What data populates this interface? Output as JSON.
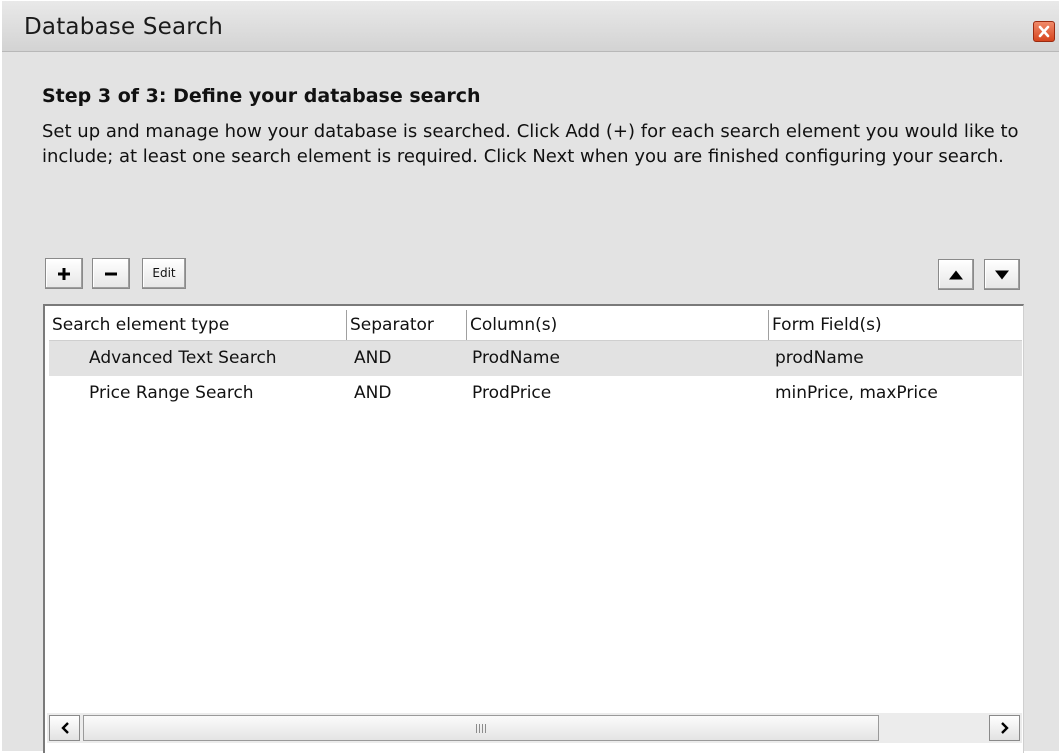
{
  "window": {
    "title": "Database Search",
    "close_icon": "close-icon"
  },
  "step": {
    "heading": "Step 3 of 3: Define your database search",
    "description": "Set up and manage how your database is searched. Click Add (+) for each search element you would like to include; at least one search element is required. Click Next when you are finished configuring your search."
  },
  "toolbar": {
    "add_icon": "plus-icon",
    "remove_icon": "minus-icon",
    "edit_label": "Edit",
    "move_up_icon": "arrow-up-icon",
    "move_down_icon": "arrow-down-icon"
  },
  "table": {
    "columns": [
      "Search element type",
      "Separator",
      "Column(s)",
      "Form Field(s)"
    ],
    "rows": [
      [
        "Advanced Text Search",
        "AND",
        "ProdName",
        "prodName"
      ],
      [
        "Price Range Search",
        "AND",
        "ProdPrice",
        "minPrice, maxPrice"
      ]
    ],
    "selected_row": 0
  },
  "scrollbar": {
    "left_icon": "scroll-left-icon",
    "right_icon": "scroll-right-icon",
    "grip_icon": "scroll-grip-icon"
  },
  "colors": {
    "dialog_bg": "#e3e3e3",
    "selected_row_bg": "#e2e2e2",
    "close_button": "#d6451e"
  }
}
